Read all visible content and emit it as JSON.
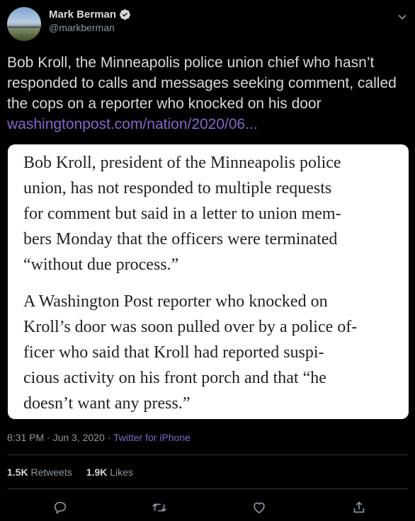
{
  "user": {
    "display_name": "Mark Berman",
    "handle": "@markberman"
  },
  "tweet": {
    "text": "Bob Kroll, the Minneapolis police union chief who hasn’t responded to calls and messages seeking comment, called the cops on a reporter who knocked on his door ",
    "link": "washingtonpost.com/nation/2020/06..."
  },
  "image_text": {
    "p1": [
      "Bob Kroll, president of the Minneapolis police",
      "union, has not responded to multiple requests",
      "for comment but said in a letter to union mem-",
      "bers Monday that the officers were terminated",
      "“without due process.”"
    ],
    "p2": [
      "A Washington Post reporter who knocked on",
      "Kroll’s door was soon pulled over by a police of-",
      "ficer who said that Kroll had reported suspi-",
      "cious activity on his front porch and that “he",
      "doesn’t want any press.”"
    ]
  },
  "meta": {
    "timestamp": "8:31 PM · Jun 3, 2020 · ",
    "source": "Twitter for iPhone"
  },
  "stats": {
    "retweets_count": "1.5K",
    "retweets_label": "Retweets",
    "likes_count": "1.9K",
    "likes_label": "Likes"
  },
  "colors": {
    "background": "#000000",
    "text": "#d9d9d9",
    "secondary": "#8b98a5",
    "link": "#8365c9",
    "divider": "#2f3336"
  },
  "icons": [
    "verified-badge-icon",
    "chevron-down-icon",
    "reply-icon",
    "retweet-icon",
    "like-icon",
    "share-icon"
  ]
}
